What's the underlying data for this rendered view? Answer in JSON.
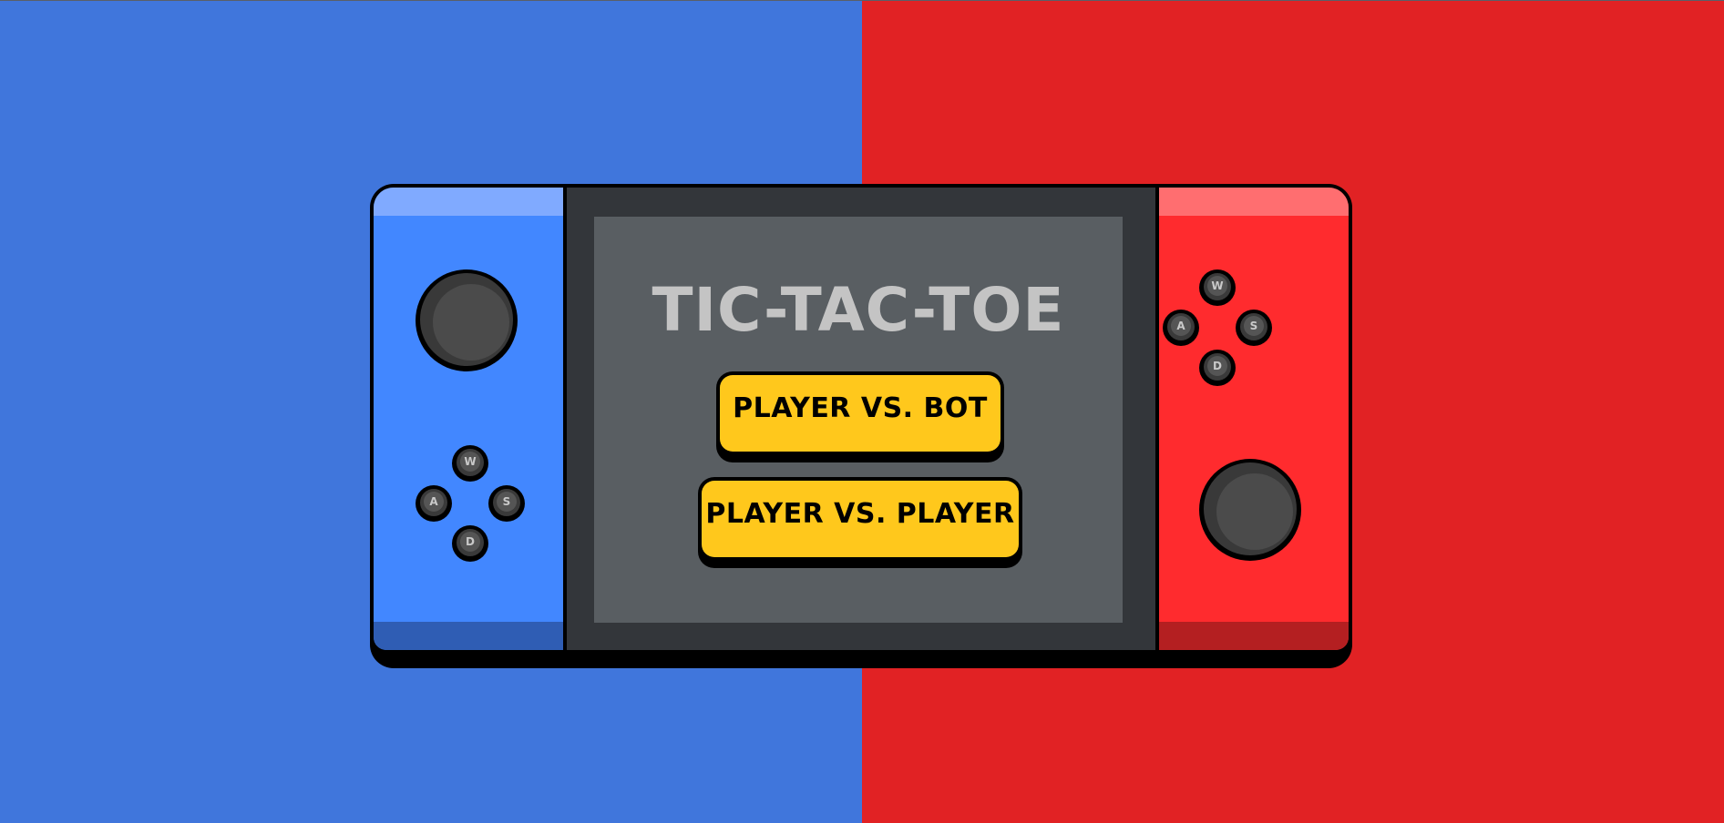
{
  "game": {
    "title": "TIC-TAC-TOE",
    "buttons": {
      "player_vs_bot": "PLAYER VS. BOT",
      "player_vs_player": "PLAYER VS. PLAYER"
    }
  },
  "left_controller": {
    "keys": {
      "up": "W",
      "left": "A",
      "right": "S",
      "down": "D"
    }
  },
  "right_controller": {
    "keys": {
      "up": "W",
      "left": "A",
      "right": "S",
      "down": "D"
    }
  },
  "colors": {
    "player_one": "#4076dc",
    "player_two": "#e12224",
    "button": "#ffc81c",
    "screen": "#595e62"
  }
}
